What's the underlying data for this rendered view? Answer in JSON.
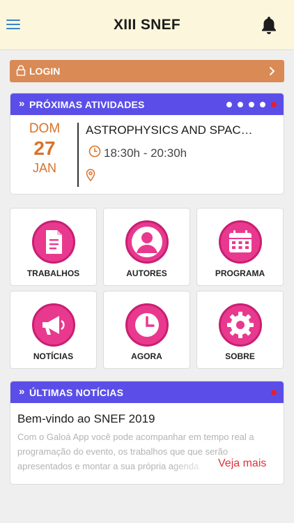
{
  "header": {
    "title": "XIII SNEF",
    "menu_icon": "hamburger-menu-icon",
    "notification_icon": "bell-icon"
  },
  "login": {
    "label": "LOGIN",
    "lock_icon": "lock-icon",
    "arrow_icon": "chevron-right-icon"
  },
  "upcoming": {
    "heading": "PRÓXIMAS ATIVIDADES",
    "chevron": "»",
    "pager": {
      "count": 5,
      "active_index": 4
    },
    "event": {
      "weekday": "DOM",
      "day": "27",
      "month": "JAN",
      "title": "ASTROPHYSICS AND SPAC…",
      "time": "18:30h - 20:30h"
    }
  },
  "tiles": [
    {
      "label": "TRABALHOS",
      "icon": "document-icon"
    },
    {
      "label": "AUTORES",
      "icon": "person-icon"
    },
    {
      "label": "PROGRAMA",
      "icon": "calendar-icon"
    },
    {
      "label": "NOTÍCIAS",
      "icon": "megaphone-icon"
    },
    {
      "label": "AGORA",
      "icon": "clock-icon"
    },
    {
      "label": "SOBRE",
      "icon": "gear-icon"
    }
  ],
  "news": {
    "heading": "ÚLTIMAS NOTÍCIAS",
    "chevron": "»",
    "title": "Bem-vindo ao SNEF 2019",
    "excerpt": "Com o Galoá App você pode acompanhar em tempo real a programação do evento, os trabalhos que que serão apresentados e montar a sua própria agenda.",
    "more_label": "Veja mais"
  },
  "colors": {
    "header_bg": "#fcf7dc",
    "login_bg": "#d98a55",
    "section_header": "#5b4ee8",
    "tile_icon": "#e9398f",
    "date_accent": "#d9722a",
    "active_dot": "#e3202e",
    "link": "#e0303a"
  }
}
